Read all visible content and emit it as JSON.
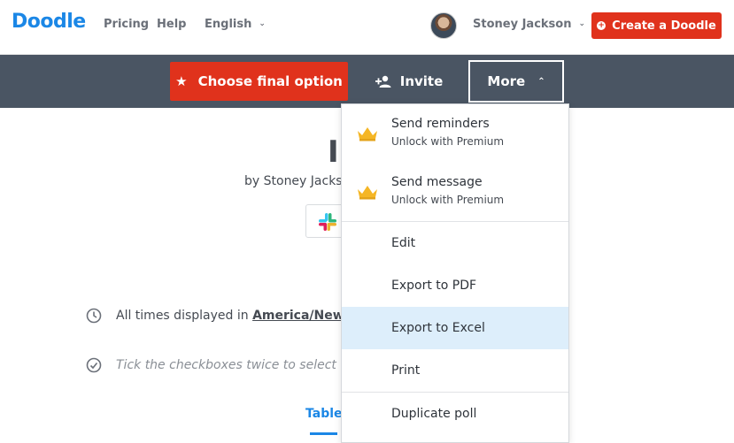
{
  "header": {
    "logo": "Doodle",
    "nav": {
      "pricing": "Pricing",
      "help": "Help",
      "language": "English"
    },
    "user": {
      "name": "Stoney Jackson"
    },
    "create_button": "Create a Doodle"
  },
  "actionbar": {
    "choose_final": "Choose final option",
    "invite": "Invite",
    "more": "More"
  },
  "poll": {
    "title_fragment": "I",
    "byline": "by Stoney Jacks",
    "timezone_prefix": "All times displayed in",
    "timezone_link": "America/New",
    "hint": "Tick the checkboxes twice to select",
    "tab_table": "Table"
  },
  "more_menu": {
    "premium_items": [
      {
        "label": "Send reminders",
        "sublabel": "Unlock with Premium"
      },
      {
        "label": "Send message",
        "sublabel": "Unlock with Premium"
      }
    ],
    "items": [
      {
        "label": "Edit"
      },
      {
        "label": "Export to PDF"
      },
      {
        "label": "Export to Excel",
        "highlighted": true
      },
      {
        "label": "Print"
      },
      {
        "label": "Duplicate poll"
      }
    ]
  },
  "colors": {
    "brand_blue": "#1b87e6",
    "primary_red": "#e0321c",
    "actionbar_bg": "#4a5563",
    "menu_highlight": "#ddeefb",
    "crown": "#f5b625"
  }
}
